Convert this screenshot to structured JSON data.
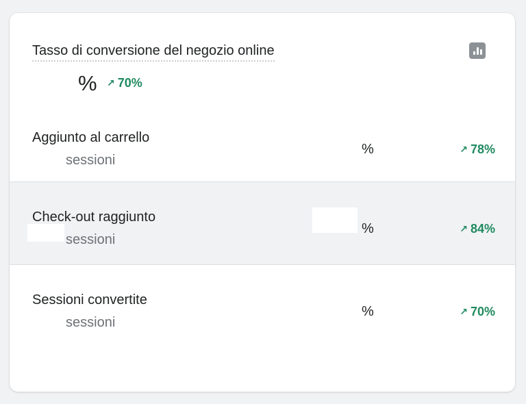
{
  "card": {
    "title": "Tasso di conversione del negozio online",
    "chart_icon": "bar-chart-icon",
    "value": "%",
    "change": "70%",
    "change_arrow": "↗"
  },
  "rows": [
    {
      "label": "Aggiunto al carrello",
      "sub": "sessioni",
      "percent": "%",
      "change": "78%"
    },
    {
      "label": "Check-out raggiunto",
      "sub": "sessioni",
      "percent": "%",
      "change": "84%"
    },
    {
      "label": "Sessioni convertite",
      "sub": "sessioni",
      "percent": "%",
      "change": "70%"
    }
  ],
  "colors": {
    "positive": "#1f8a5f",
    "highlight_row": "#f1f2f4",
    "icon_bg": "#8c9196"
  }
}
